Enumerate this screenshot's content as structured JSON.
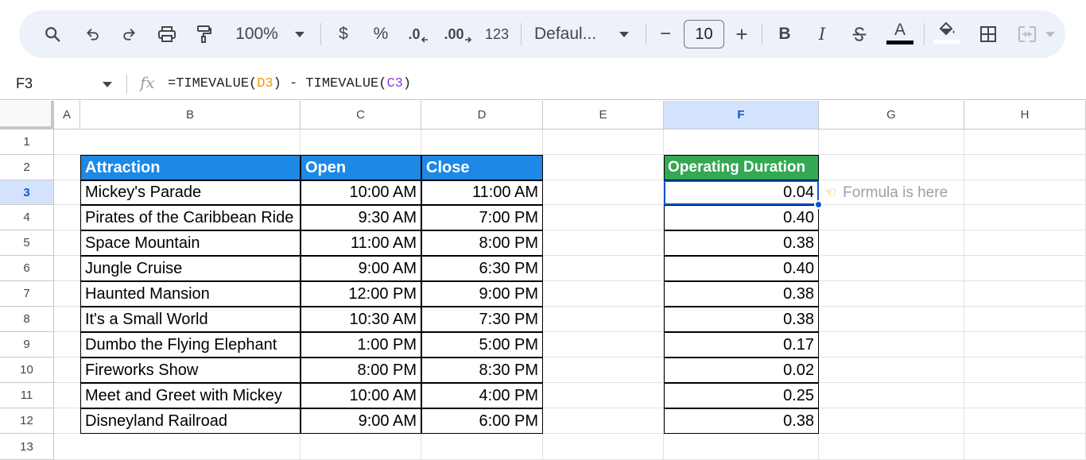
{
  "toolbar": {
    "zoom": "100%",
    "currency": "$",
    "percent": "%",
    "decrease_decimal": ".0",
    "increase_decimal": ".00",
    "number_format": "123",
    "font_family": "Defaul...",
    "font_size": "10",
    "font_size_minus": "−",
    "font_size_plus": "+",
    "bold": "B",
    "italic": "I",
    "text_color_label": "A",
    "icons": [
      "search-icon",
      "undo-icon",
      "redo-icon",
      "print-icon",
      "paint-format-icon",
      "chevron-down-icon",
      "strikethrough-icon",
      "fill-color-icon",
      "borders-icon",
      "merge-cells-icon"
    ],
    "text_color": "#000000",
    "fill_color": "#ffffff"
  },
  "formula_bar": {
    "cell_ref": "F3",
    "fx": "fx",
    "formula_prefix": "=TIMEVALUE(",
    "ref1": "D3",
    "formula_mid": ") - TIMEVALUE(",
    "ref2": "C3",
    "formula_suffix": ")"
  },
  "columns": [
    "A",
    "B",
    "C",
    "D",
    "E",
    "F",
    "G",
    "H"
  ],
  "rows": [
    "1",
    "2",
    "3",
    "4",
    "5",
    "6",
    "7",
    "8",
    "9",
    "10",
    "11",
    "12",
    "13"
  ],
  "selected": {
    "column": "F",
    "row": "3"
  },
  "table": {
    "headers": {
      "attraction": "Attraction",
      "open": "Open",
      "close": "Close"
    },
    "rows": [
      {
        "attraction": "Mickey's Parade",
        "open": "10:00 AM",
        "close": "11:00 AM"
      },
      {
        "attraction": "Pirates of the Caribbean Ride",
        "open": "9:30 AM",
        "close": "7:00 PM"
      },
      {
        "attraction": "Space Mountain",
        "open": "11:00 AM",
        "close": "8:00 PM"
      },
      {
        "attraction": "Jungle Cruise",
        "open": "9:00 AM",
        "close": "6:30 PM"
      },
      {
        "attraction": "Haunted Mansion",
        "open": "12:00 PM",
        "close": "9:00 PM"
      },
      {
        "attraction": "It's a Small World",
        "open": "10:30 AM",
        "close": "7:30 PM"
      },
      {
        "attraction": "Dumbo the Flying Elephant",
        "open": "1:00 PM",
        "close": "5:00 PM"
      },
      {
        "attraction": "Fireworks Show",
        "open": "8:00 PM",
        "close": "8:30 PM"
      },
      {
        "attraction": "Meet and Greet with Mickey",
        "open": "10:00 AM",
        "close": "4:00 PM"
      },
      {
        "attraction": "Disneyland Railroad",
        "open": "9:00 AM",
        "close": "6:00 PM"
      }
    ]
  },
  "duration": {
    "header": "Operating Duration",
    "values": [
      "0.04",
      "0.40",
      "0.38",
      "0.40",
      "0.38",
      "0.38",
      "0.17",
      "0.02",
      "0.25",
      "0.38"
    ]
  },
  "note": {
    "icon": "pointing-hand-icon",
    "text": "Formula is here"
  },
  "colors": {
    "header_blue": "#1e88e5",
    "header_green": "#34a853",
    "selection": "#0b57d0",
    "selected_header": "#d3e3fd",
    "toolbar_bg": "#edf2fa"
  }
}
